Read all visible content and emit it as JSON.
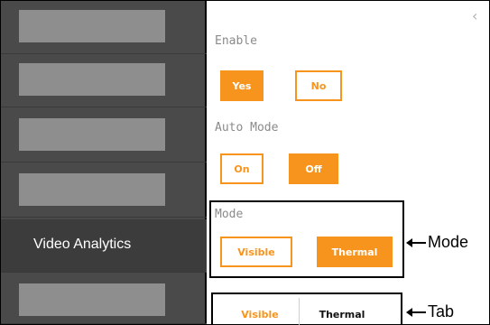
{
  "sidebar": {
    "items": [
      {
        "label": ""
      },
      {
        "label": ""
      },
      {
        "label": ""
      },
      {
        "label": ""
      },
      {
        "label": "Video Analytics"
      },
      {
        "label": ""
      }
    ]
  },
  "panel": {
    "collapse_icon": "chevron-left-icon",
    "collapse_glyph": "‹",
    "enable": {
      "label": "Enable",
      "yes": "Yes",
      "no": "No",
      "selected": "Yes"
    },
    "auto_mode": {
      "label": "Auto Mode",
      "on": "On",
      "off": "Off",
      "selected": "Off"
    },
    "mode": {
      "label": "Mode",
      "visible": "Visible",
      "thermal": "Thermal",
      "selected": "Thermal"
    },
    "tabs": {
      "visible": "Visible",
      "thermal": "Thermal"
    }
  },
  "annotations": {
    "mode": "Mode",
    "tab": "Tab"
  },
  "colors": {
    "accent": "#f7941d",
    "sidebar": "#4a4a4a",
    "sidebar_placeholder": "#8e8e8e"
  }
}
